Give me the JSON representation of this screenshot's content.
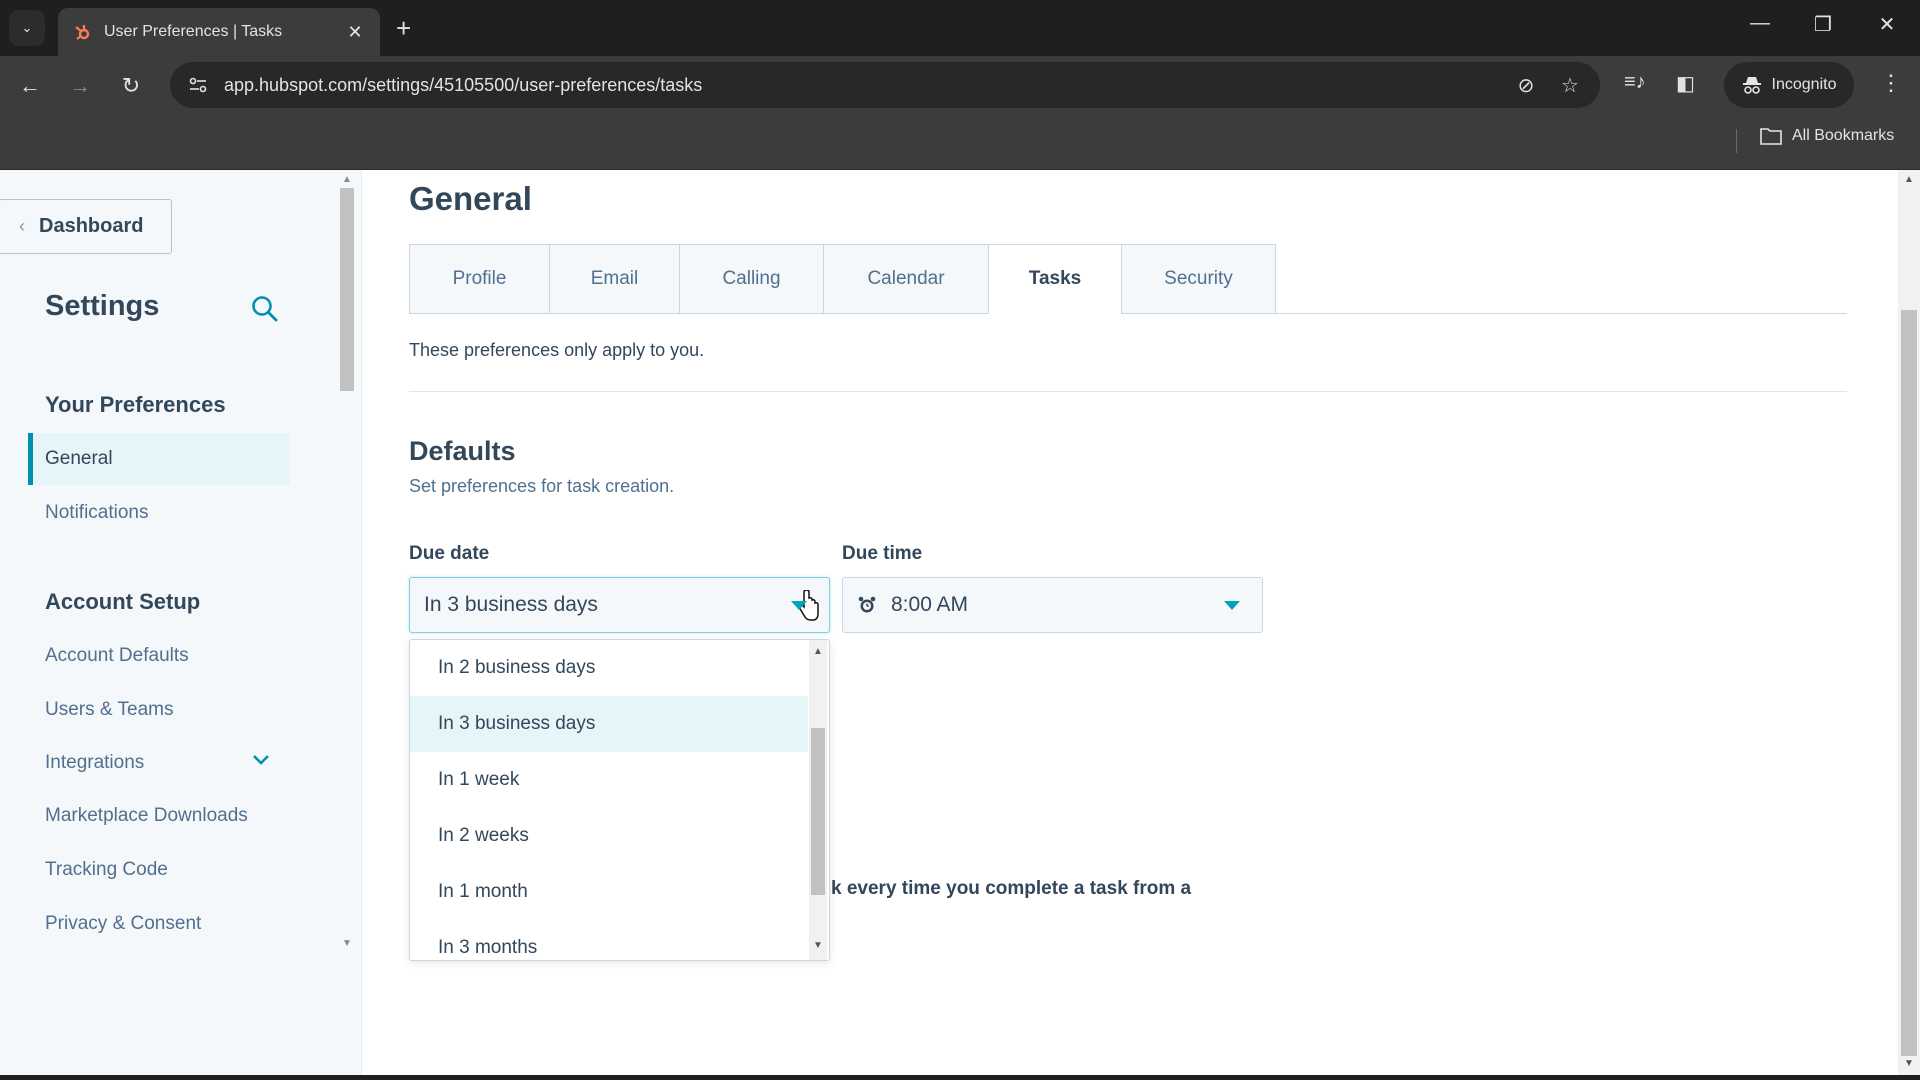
{
  "browser": {
    "tab_title": "User Preferences | Tasks",
    "url": "app.hubspot.com/settings/45105500/user-preferences/tasks",
    "incognito_label": "Incognito",
    "bookmarks_label": "All Bookmarks",
    "icons": {
      "tab_search": "chevron-down-icon",
      "favicon": "hubspot-sprocket-icon",
      "close": "close-icon",
      "new_tab": "plus-icon",
      "back": "arrow-left-icon",
      "forward": "arrow-right-icon",
      "reload": "reload-icon",
      "site_info": "tune-icon",
      "eye_off": "eye-off-icon",
      "bookmark": "star-icon",
      "media": "playlist-icon",
      "side_panel": "side-panel-icon",
      "menu": "more-vertical-icon",
      "folder": "folder-icon"
    },
    "glyphs": {
      "chevron": "⌄",
      "close": "✕",
      "plus": "+",
      "back": "←",
      "forward": "→",
      "reload": "↻",
      "eye_off": "⊘",
      "star": "☆",
      "media": "≡♪",
      "side_panel": "◧",
      "dots": "⋮",
      "minimize": "—",
      "restore": "❐",
      "window_close": "✕"
    }
  },
  "sidebar": {
    "back_button": "Dashboard",
    "back_chevron": "‹",
    "title": "Settings",
    "sections": [
      {
        "heading": "Your Preferences",
        "items": [
          {
            "label": "General",
            "active": true
          },
          {
            "label": "Notifications",
            "active": false
          }
        ]
      },
      {
        "heading": "Account Setup",
        "items": [
          {
            "label": "Account Defaults",
            "active": false
          },
          {
            "label": "Users & Teams",
            "active": false
          },
          {
            "label": "Integrations",
            "active": false,
            "expandable": true
          },
          {
            "label": "Marketplace Downloads",
            "active": false
          },
          {
            "label": "Tracking Code",
            "active": false
          },
          {
            "label": "Privacy & Consent",
            "active": false
          }
        ]
      }
    ]
  },
  "main": {
    "title": "General",
    "tabs": [
      {
        "label": "Profile",
        "active": false
      },
      {
        "label": "Email",
        "active": false
      },
      {
        "label": "Calling",
        "active": false
      },
      {
        "label": "Calendar",
        "active": false
      },
      {
        "label": "Tasks",
        "active": true
      },
      {
        "label": "Security",
        "active": false
      }
    ],
    "intro": "These preferences only apply to you.",
    "defaults": {
      "title": "Defaults",
      "subtitle": "Set preferences for task creation.",
      "due_date": {
        "label": "Due date",
        "value": "In 3 business days",
        "options": [
          "In 2 business days",
          "In 3 business days",
          "In 1 week",
          "In 2 weeks",
          "In 1 month",
          "In 3 months"
        ],
        "selected_index": 1
      },
      "due_time": {
        "label": "Due time",
        "value": "8:00 AM"
      }
    },
    "partial_text": "k every time you complete a task from a"
  },
  "colors": {
    "accent": "#00a4bd",
    "active_nav": "#0091ae",
    "text": "#33475b",
    "muted": "#516f90",
    "hubspot_orange": "#ff7a59"
  }
}
